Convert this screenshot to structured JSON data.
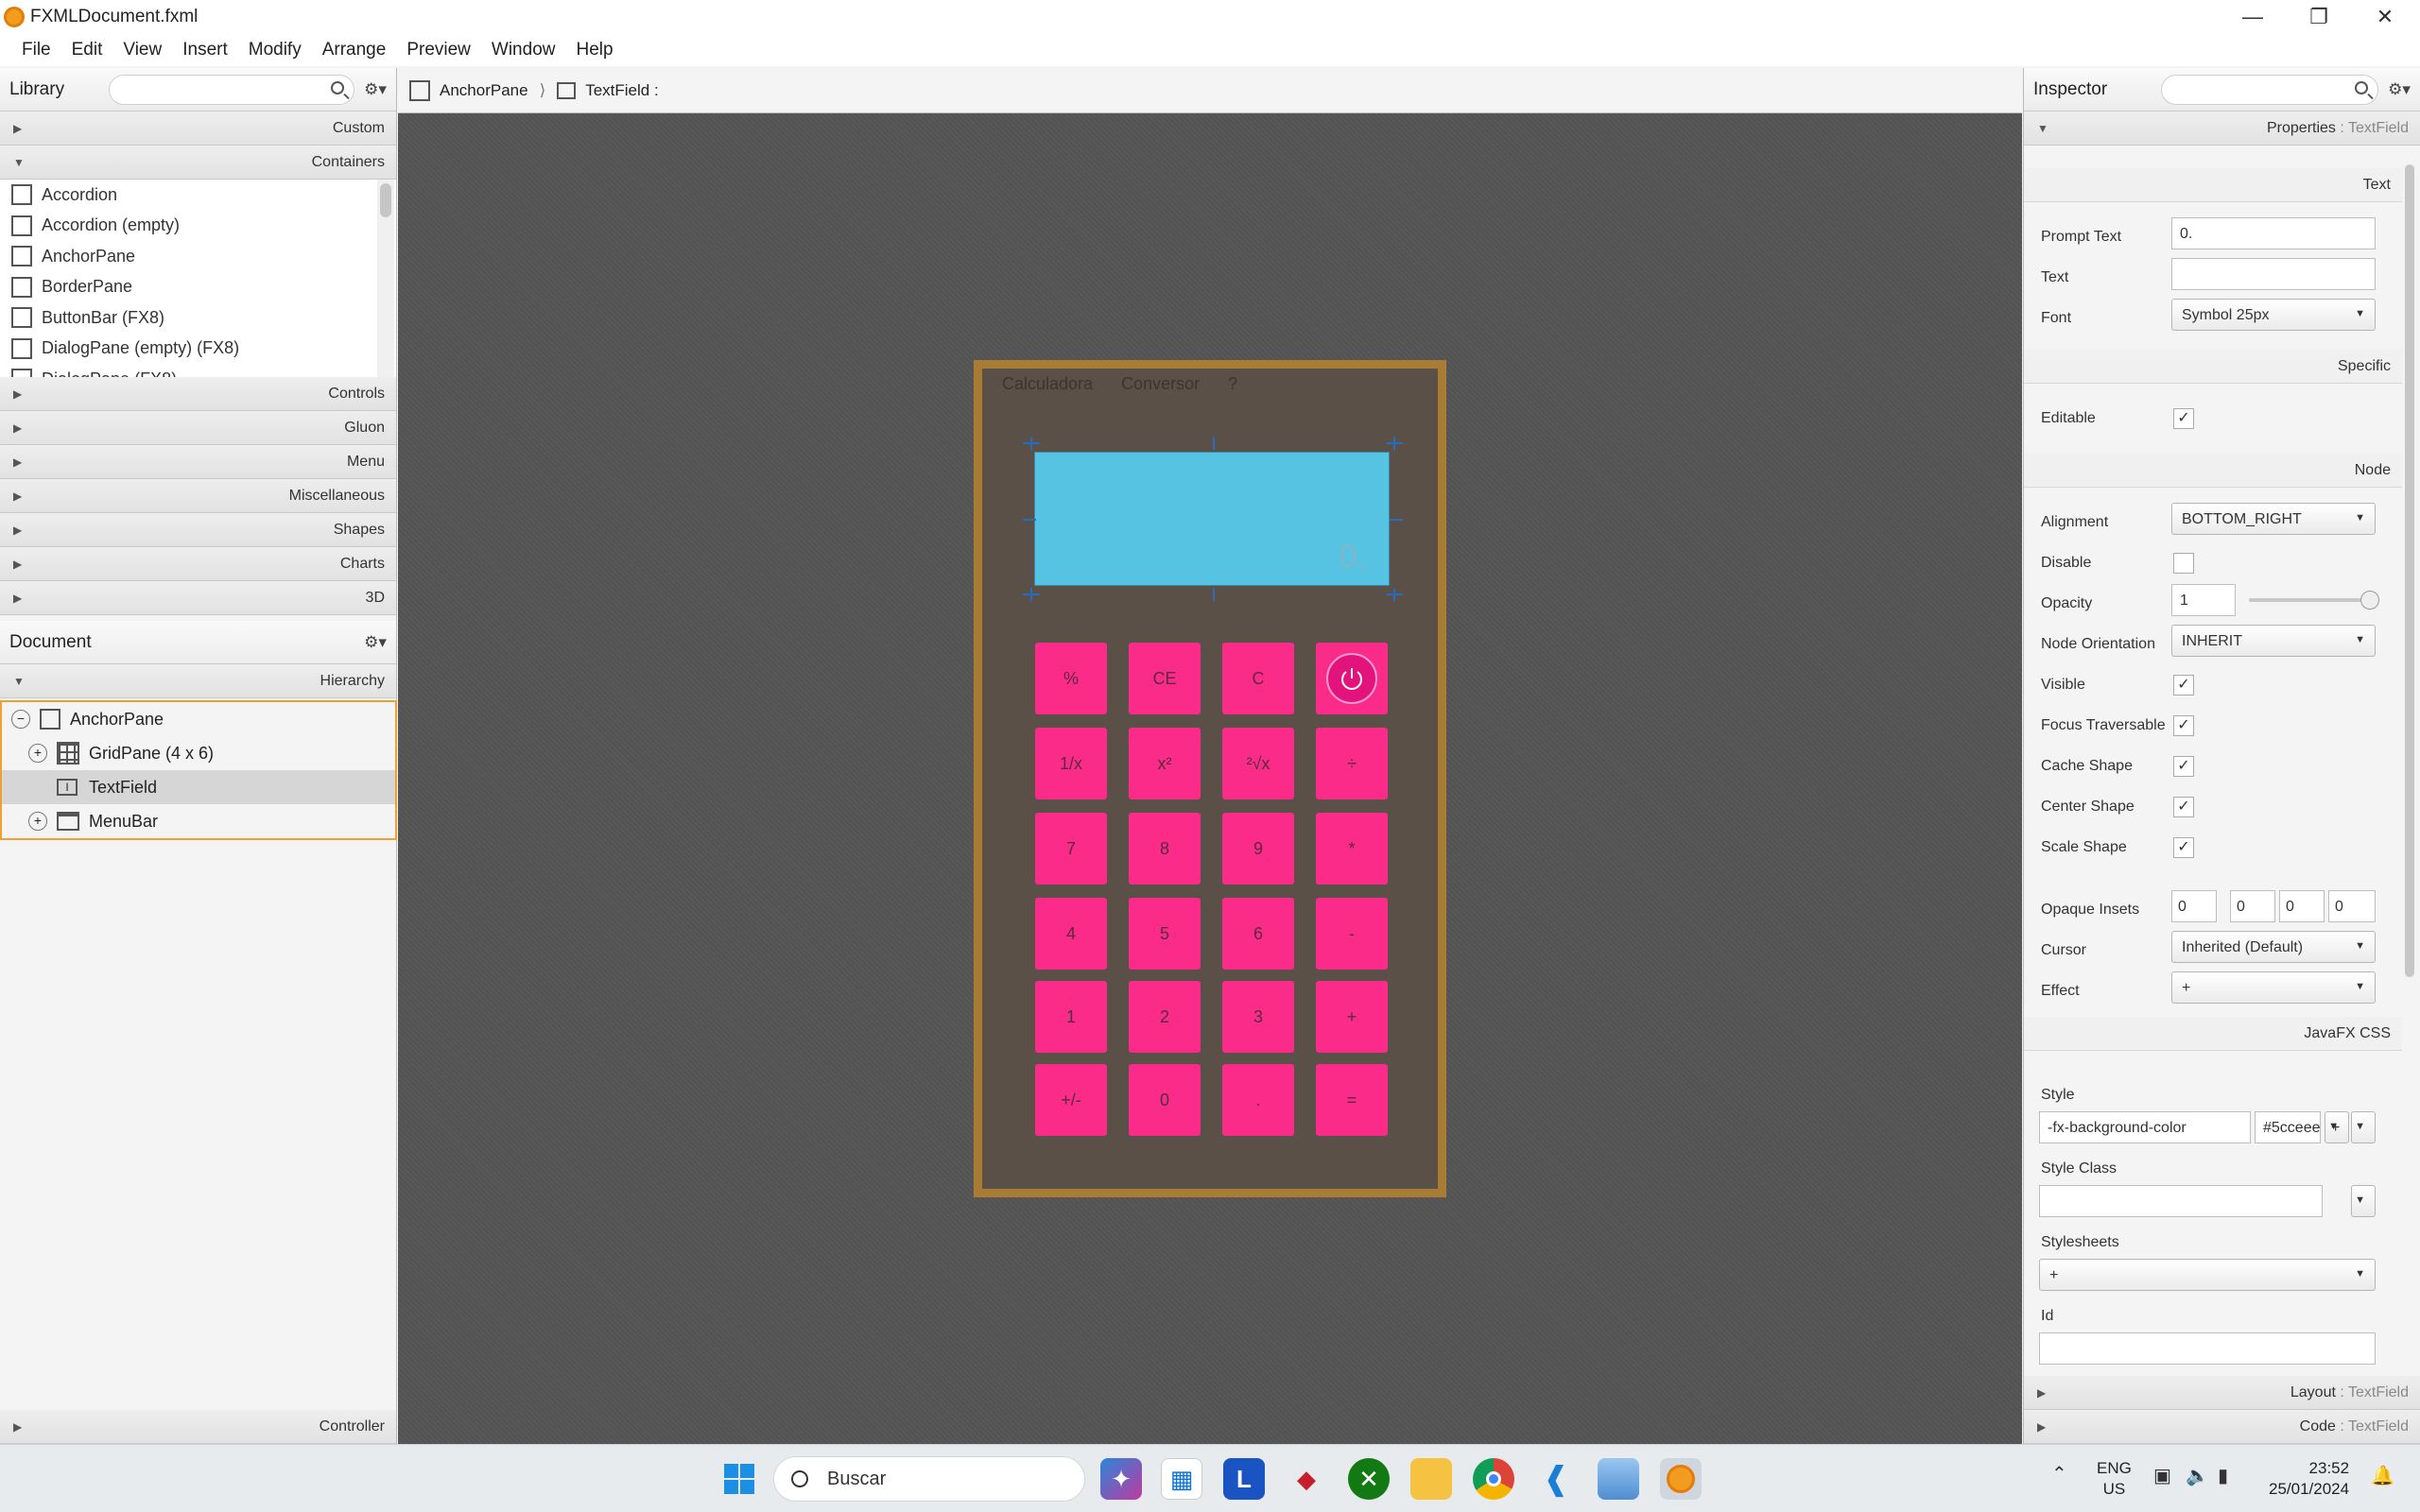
{
  "window": {
    "title": "FXMLDocument.fxml"
  },
  "menubar": {
    "items": [
      "File",
      "Edit",
      "View",
      "Insert",
      "Modify",
      "Arrange",
      "Preview",
      "Window",
      "Help"
    ]
  },
  "library": {
    "title": "Library",
    "sections_top": [
      "Custom",
      "Containers"
    ],
    "items": [
      "Accordion",
      "Accordion  (empty)",
      "AnchorPane",
      "BorderPane",
      "ButtonBar  (FX8)",
      "DialogPane (empty)  (FX8)",
      "DialogPane  (FX8)"
    ],
    "sections_bottom": [
      "Controls",
      "Gluon",
      "Menu",
      "Miscellaneous",
      "Shapes",
      "Charts",
      "3D"
    ]
  },
  "document": {
    "title": "Document",
    "hierarchy_label": "Hierarchy",
    "nodes": [
      "AnchorPane",
      "GridPane (4 x 6)",
      "TextField",
      "MenuBar"
    ],
    "controller_label": "Controller"
  },
  "breadcrumb": {
    "root": "AnchorPane",
    "current": "TextField :"
  },
  "calculator": {
    "menu": [
      "Calculadora",
      "Conversor",
      "?"
    ],
    "display_value": "0.",
    "keys": [
      [
        "%",
        "CE",
        "C",
        "⏻"
      ],
      [
        "1/x",
        "x²",
        "²√x",
        "÷"
      ],
      [
        "7",
        "8",
        "9",
        "*"
      ],
      [
        "4",
        "5",
        "6",
        "-"
      ],
      [
        "1",
        "2",
        "3",
        "+"
      ],
      [
        "+/-",
        "0",
        ".",
        "="
      ]
    ],
    "colors": {
      "frame": "#a87c32",
      "body": "#5b5047",
      "display": "#56c3e2",
      "key": "#fb2b8a"
    }
  },
  "inspector": {
    "title": "Inspector",
    "properties_label": "Properties",
    "properties_target": ": TextField",
    "sections": {
      "text": "Text",
      "specific": "Specific",
      "node": "Node",
      "css": "JavaFX CSS"
    },
    "labels": {
      "prompt": "Prompt Text",
      "text": "Text",
      "font": "Font",
      "editable": "Editable",
      "alignment": "Alignment",
      "disable": "Disable",
      "opacity": "Opacity",
      "orientation": "Node Orientation",
      "visible": "Visible",
      "focus": "Focus Traversable",
      "cache": "Cache Shape",
      "center": "Center Shape",
      "scale": "Scale Shape",
      "insets": "Opaque Insets",
      "cursor": "Cursor",
      "effect": "Effect",
      "style": "Style",
      "styleclass": "Style Class",
      "stylesheets": "Stylesheets",
      "id": "Id"
    },
    "values": {
      "prompt": "0.",
      "text": "",
      "font": "Symbol 25px",
      "alignment": "BOTTOM_RIGHT",
      "opacity": "1",
      "orientation": "INHERIT",
      "insets": [
        "0",
        "0",
        "0",
        "0"
      ],
      "cursor": "Inherited (Default)",
      "effect": "+",
      "style_prop": "-fx-background-color",
      "style_val": "#5cceee",
      "plus": "+"
    },
    "layout_label": "Layout",
    "layout_target": ": TextField",
    "code_label": "Code",
    "code_target": ": TextField"
  },
  "taskbar": {
    "search": "Buscar",
    "lang1": "ENG",
    "lang2": "US",
    "time": "23:52",
    "date": "25/01/2024"
  }
}
